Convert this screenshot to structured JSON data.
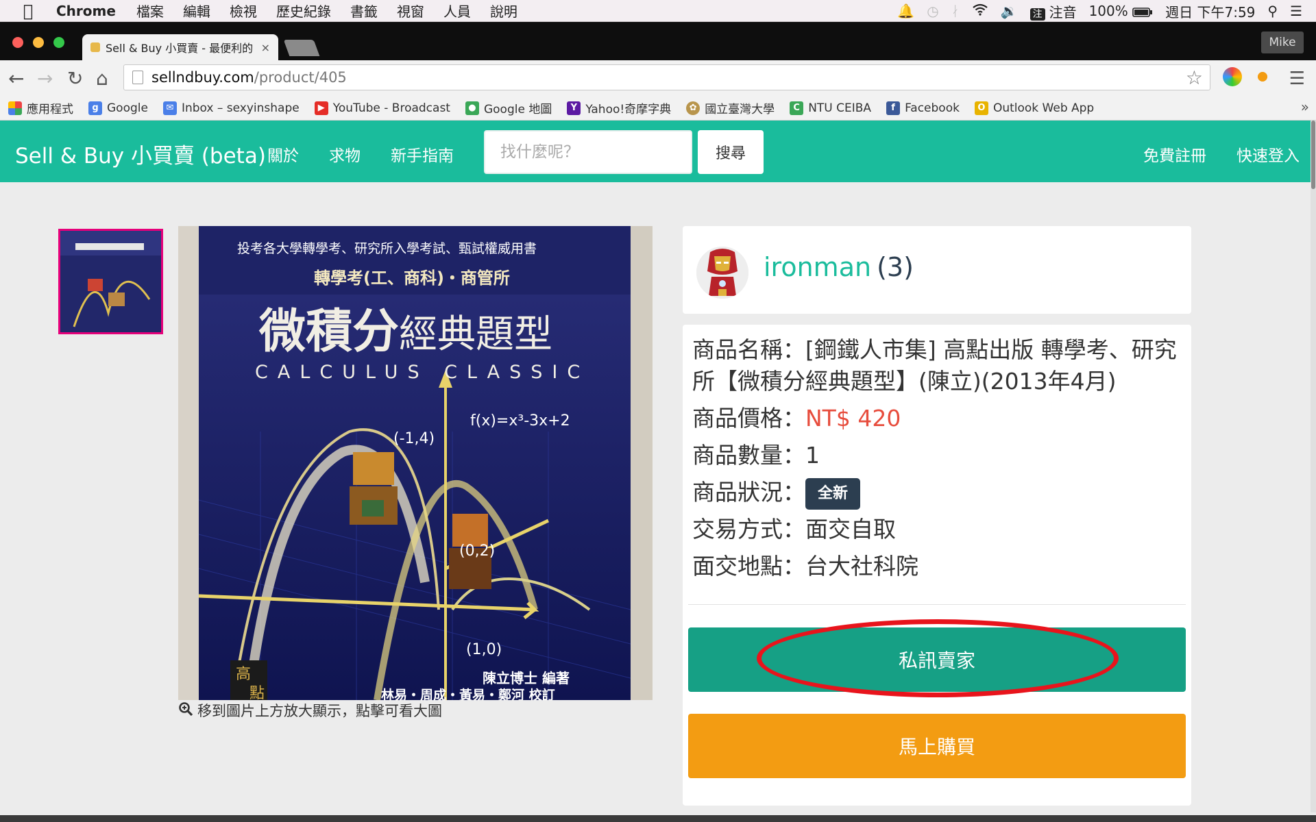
{
  "menubar": {
    "app": "Chrome",
    "items": [
      "檔案",
      "編輯",
      "檢視",
      "歷史紀錄",
      "書籤",
      "視窗",
      "人員",
      "說明"
    ],
    "ime_icon": "注",
    "ime": "注音",
    "battery": "100%",
    "clock": "週日 下午7:59"
  },
  "browser": {
    "tab_title": "Sell & Buy 小買賣 - 最便利的",
    "tab_close": "×",
    "profile": "Mike",
    "url_host": "sellndbuy.com",
    "url_path": "/product/405",
    "bookmarks": [
      {
        "label": "應用程式",
        "color": "#e44"
      },
      {
        "label": "Google",
        "color": "#4a7fe8",
        "glyph": "g"
      },
      {
        "label": "Inbox – sexyinshape",
        "color": "#4a7fe8"
      },
      {
        "label": "YouTube - Broadcast",
        "color": "#e52d27"
      },
      {
        "label": "Google 地圖",
        "color": "#3aa757"
      },
      {
        "label": "Yahoo!奇摩字典",
        "color": "#5c1aa3",
        "glyph": "Y"
      },
      {
        "label": "國立臺灣大學",
        "color": "#b8954c"
      },
      {
        "label": "NTU CEIBA",
        "color": "#3aa757",
        "glyph": "C"
      },
      {
        "label": "Facebook",
        "color": "#3b5998",
        "glyph": "f"
      },
      {
        "label": "Outlook Web App",
        "color": "#e8b300",
        "glyph": "O"
      }
    ],
    "bookmarks_more": "»"
  },
  "site": {
    "brand": "Sell & Buy 小買賣 (beta)",
    "nav": [
      "關於",
      "求物",
      "新手指南"
    ],
    "search_placeholder": "找什麼呢？",
    "search_button": "搜尋",
    "register": "免費註冊",
    "login": "快速登入"
  },
  "product": {
    "zoom_hint": "移到圖片上方放大顯示，點擊可看大圖",
    "book": {
      "header": "投考各大學轉學考、研究所入學考試、甄試權威用書",
      "subtitle": "轉學考(工、商科)・商管所",
      "title_big": "微積分",
      "title_small": "經典題型",
      "title_en": "CALCULUS CLASSIC",
      "formula": "f(x)=x³-3x+2",
      "pt1": "(-1,4)",
      "pt2": "(0,2)",
      "pt3": "(1,0)",
      "author": "陳立博士 編著",
      "editors": "林易・周成・黃易・鄭河 校訂",
      "publisher_1": "高",
      "publisher_2": "點"
    },
    "seller": {
      "name": "ironman",
      "count": "(3)"
    },
    "name_label": "商品名稱：",
    "name_value": "[鋼鐵人市集] 高點出版 轉學考、研究所【微積分經典題型】(陳立)(2013年4月)",
    "price_label": "商品價格：",
    "price_value": "NT$ 420",
    "qty_label": "商品數量：",
    "qty_value": "1",
    "condition_label": "商品狀況：",
    "condition_value": "全新",
    "trade_label": "交易方式：",
    "trade_value": "面交自取",
    "place_label": "面交地點：",
    "place_value": "台大社科院",
    "message_button": "私訊賣家",
    "buy_button": "馬上購買"
  },
  "colors": {
    "brand": "#1abc9c",
    "message": "#16a085",
    "buy": "#f39c12",
    "price": "#e74c3c",
    "badge": "#2c3e50",
    "annotation": "#e8141c"
  }
}
